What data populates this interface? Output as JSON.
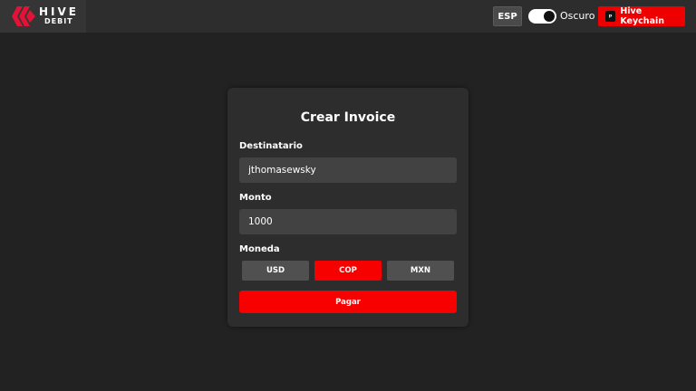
{
  "header": {
    "logo_word": "HIVE",
    "logo_sub": "DEBIT",
    "language_label": "ESP",
    "theme_label": "Oscuro",
    "keychain_label": "Hive Keychain"
  },
  "form": {
    "title": "Crear Invoice",
    "recipient_label": "Destinatario",
    "recipient_value": "jthomasewsky",
    "amount_label": "Monto",
    "amount_value": "1000",
    "currency_label": "Moneda",
    "currencies": [
      "USD",
      "COP",
      "MXN"
    ],
    "selected_currency": "COP",
    "pay_label": "Pagar"
  },
  "colors": {
    "accent": "#f70000",
    "background": "#222222",
    "card": "#2d2d2d"
  }
}
